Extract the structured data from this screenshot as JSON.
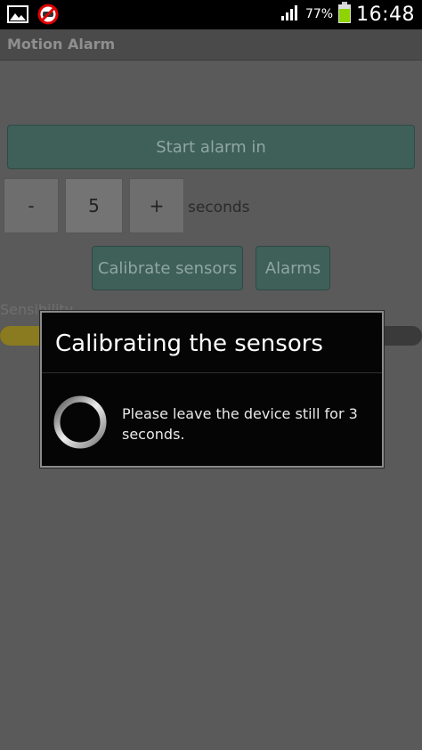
{
  "status_bar": {
    "battery_percent": "77%",
    "time": "16:48",
    "icons": [
      "gallery-icon",
      "no-notification-icon",
      "signal-icon",
      "battery-icon"
    ]
  },
  "app": {
    "title": "Motion Alarm"
  },
  "controls": {
    "start_label": "Start alarm in",
    "minus_label": "-",
    "delay_value": "5",
    "plus_label": "+",
    "seconds_label": "seconds",
    "calibrate_label": "Calibrate sensors",
    "alarms_label": "Alarms",
    "sensibility_label": "Sensibility",
    "sensibility_level": 0.1
  },
  "dialog": {
    "title": "Calibrating the sensors",
    "message": "Please leave the device still for 3 seconds."
  },
  "colors": {
    "button_teal": "#3f5f59",
    "slider_fill": "#8a7a20",
    "battery_green": "#8fd400",
    "dialog_bg": "#050505"
  }
}
